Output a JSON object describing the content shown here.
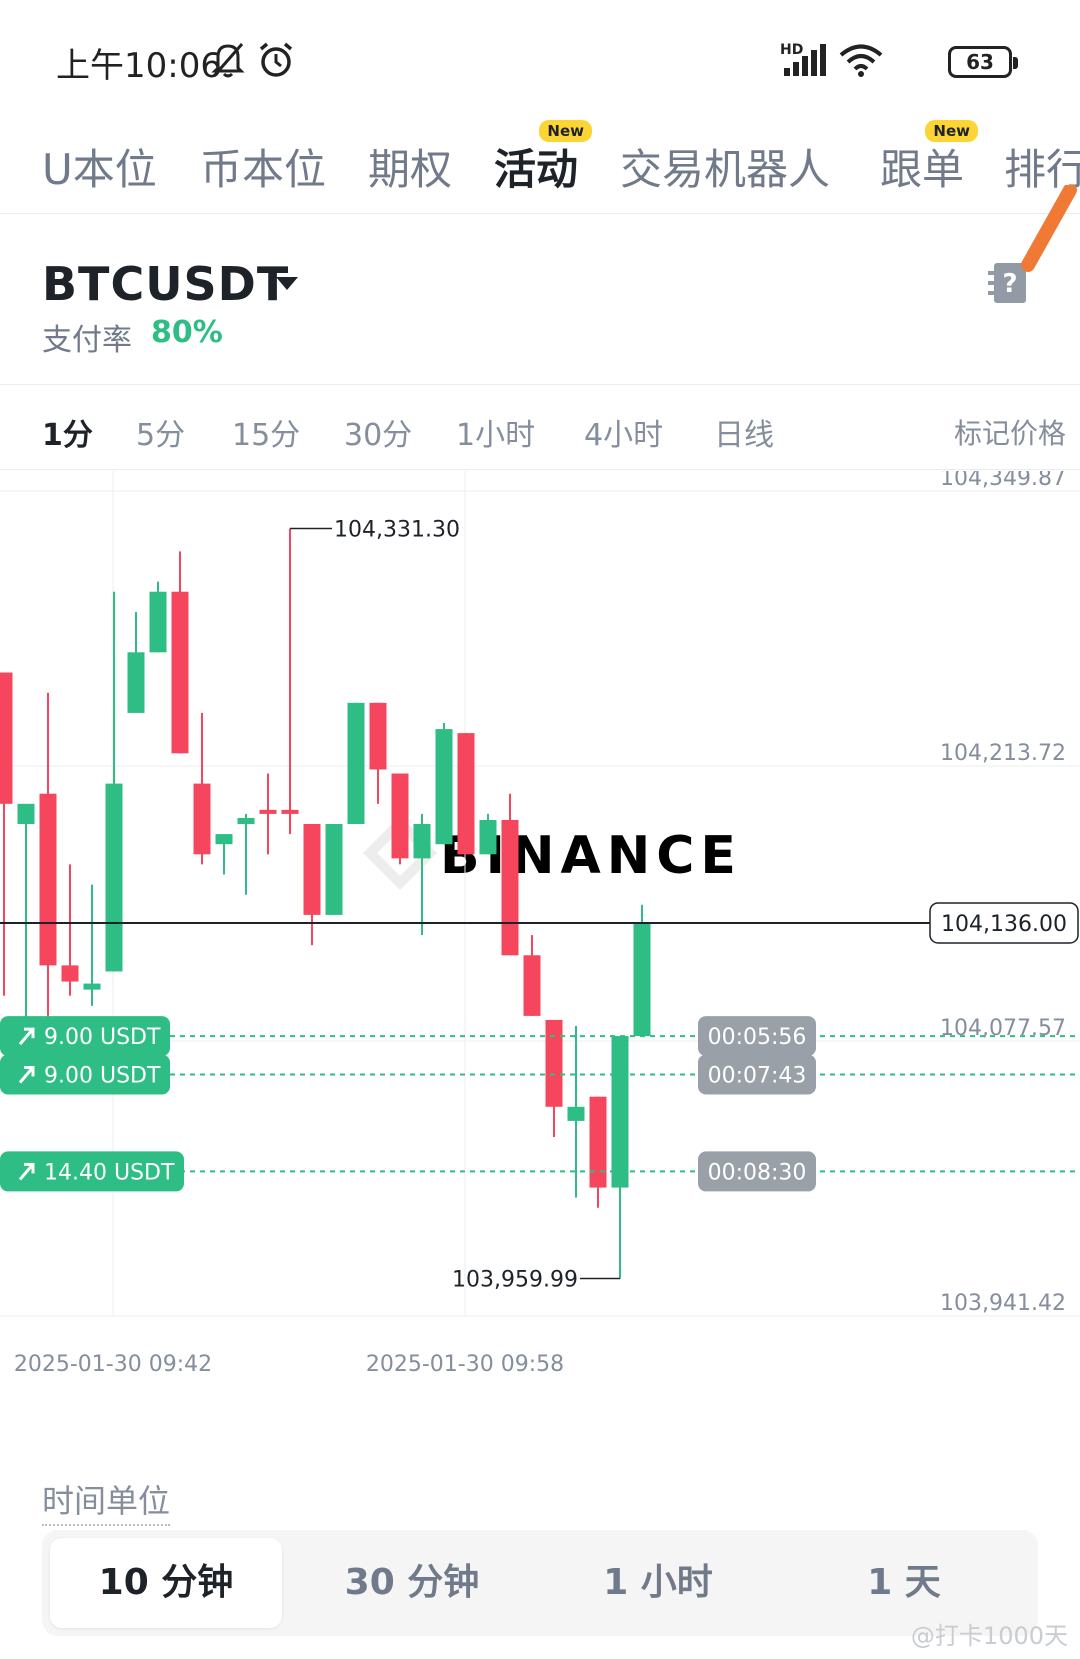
{
  "status_bar": {
    "time": "上午10:06",
    "network": "HD",
    "battery": "63"
  },
  "tabs": [
    {
      "label": "U本位",
      "active": false,
      "new": false
    },
    {
      "label": "币本位",
      "active": false,
      "new": false
    },
    {
      "label": "期权",
      "active": false,
      "new": false
    },
    {
      "label": "活动",
      "active": true,
      "new": true
    },
    {
      "label": "交易机器人",
      "active": false,
      "new": false
    },
    {
      "label": "跟单",
      "active": false,
      "new": true
    },
    {
      "label": "排行",
      "active": false,
      "new": false
    }
  ],
  "new_badge_label": "New",
  "header": {
    "symbol": "BTCUSDT",
    "payout_label": "支付率",
    "payout_value": "80%"
  },
  "timeframes": [
    {
      "label": "1分",
      "active": true
    },
    {
      "label": "5分",
      "active": false
    },
    {
      "label": "15分",
      "active": false
    },
    {
      "label": "30分",
      "active": false
    },
    {
      "label": "1小时",
      "active": false
    },
    {
      "label": "4小时",
      "active": false
    },
    {
      "label": "日线",
      "active": false
    }
  ],
  "mark_price_label": "标记价格",
  "colors": {
    "up": "#2ebd85",
    "down": "#f6465d",
    "badge": "#fcd535",
    "timer_bg": "#9aa0a8"
  },
  "chart_data": {
    "type": "candlestick",
    "watermark": "BINANCE",
    "y_axis_labels": [
      "104,349.87",
      "104,213.72",
      "104,077.57",
      "103,941.42"
    ],
    "x_axis_labels": [
      "2025-01-30 09:42",
      "2025-01-30 09:58"
    ],
    "current_price": "104,136.00",
    "high_label": "104,331.30",
    "low_label": "103,959.99",
    "candles": [
      {
        "o": 104260,
        "h": 104260,
        "l": 104100,
        "c": 104195
      },
      {
        "o": 104185,
        "h": 104185,
        "l": 104085,
        "c": 104195
      },
      {
        "o": 104200,
        "h": 104250,
        "l": 104085,
        "c": 104115
      },
      {
        "o": 104115,
        "h": 104165,
        "l": 104100,
        "c": 104107
      },
      {
        "o": 104103,
        "h": 104155,
        "l": 104095,
        "c": 104106
      },
      {
        "o": 104112,
        "h": 104300,
        "l": 104112,
        "c": 104205
      },
      {
        "o": 104240,
        "h": 104290,
        "l": 104240,
        "c": 104270
      },
      {
        "o": 104270,
        "h": 104305,
        "l": 104270,
        "c": 104300
      },
      {
        "o": 104300,
        "h": 104320,
        "l": 104220,
        "c": 104220
      },
      {
        "o": 104205,
        "h": 104240,
        "l": 104165,
        "c": 104170
      },
      {
        "o": 104175,
        "h": 104180,
        "l": 104160,
        "c": 104180
      },
      {
        "o": 104185,
        "h": 104190,
        "l": 104150,
        "c": 104188
      },
      {
        "o": 104192,
        "h": 104210,
        "l": 104170,
        "c": 104190
      },
      {
        "o": 104192,
        "h": 104331.3,
        "l": 104180,
        "c": 104190
      },
      {
        "o": 104185,
        "h": 104185,
        "l": 104125,
        "c": 104140
      },
      {
        "o": 104140,
        "h": 104185,
        "l": 104140,
        "c": 104185
      },
      {
        "o": 104185,
        "h": 104245,
        "l": 104185,
        "c": 104245
      },
      {
        "o": 104245,
        "h": 104245,
        "l": 104195,
        "c": 104212
      },
      {
        "o": 104210,
        "h": 104210,
        "l": 104165,
        "c": 104168
      },
      {
        "o": 104168,
        "h": 104190,
        "l": 104130,
        "c": 104185
      },
      {
        "o": 104175,
        "h": 104235,
        "l": 104175,
        "c": 104232
      },
      {
        "o": 104230,
        "h": 104230,
        "l": 104170,
        "c": 104170
      },
      {
        "o": 104170,
        "h": 104190,
        "l": 104170,
        "c": 104187
      },
      {
        "o": 104187,
        "h": 104200,
        "l": 104120,
        "c": 104120
      },
      {
        "o": 104120,
        "h": 104130,
        "l": 104090,
        "c": 104090
      },
      {
        "o": 104088,
        "h": 104088,
        "l": 104030,
        "c": 104045
      },
      {
        "o": 104038,
        "h": 104085,
        "l": 104000,
        "c": 104045
      },
      {
        "o": 104050,
        "h": 104050,
        "l": 103995,
        "c": 104005
      },
      {
        "o": 104005,
        "h": 104080,
        "l": 103959.99,
        "c": 104080
      },
      {
        "o": 104080,
        "h": 104145,
        "l": 104080,
        "c": 104136
      }
    ],
    "orders": [
      {
        "amount": "9.00 USDT",
        "timer": "00:05:56",
        "price": 104080
      },
      {
        "amount": "9.00 USDT",
        "timer": "00:07:43",
        "price": 104061
      },
      {
        "amount": "14.40 USDT",
        "timer": "00:08:30",
        "price": 104013
      }
    ]
  },
  "time_unit_label": "时间单位",
  "time_units": [
    {
      "label": "10 分钟",
      "active": true
    },
    {
      "label": "30 分钟",
      "active": false
    },
    {
      "label": "1 小时",
      "active": false
    },
    {
      "label": "1 天",
      "active": false
    }
  ],
  "watermark_text": "@打卡1000天"
}
